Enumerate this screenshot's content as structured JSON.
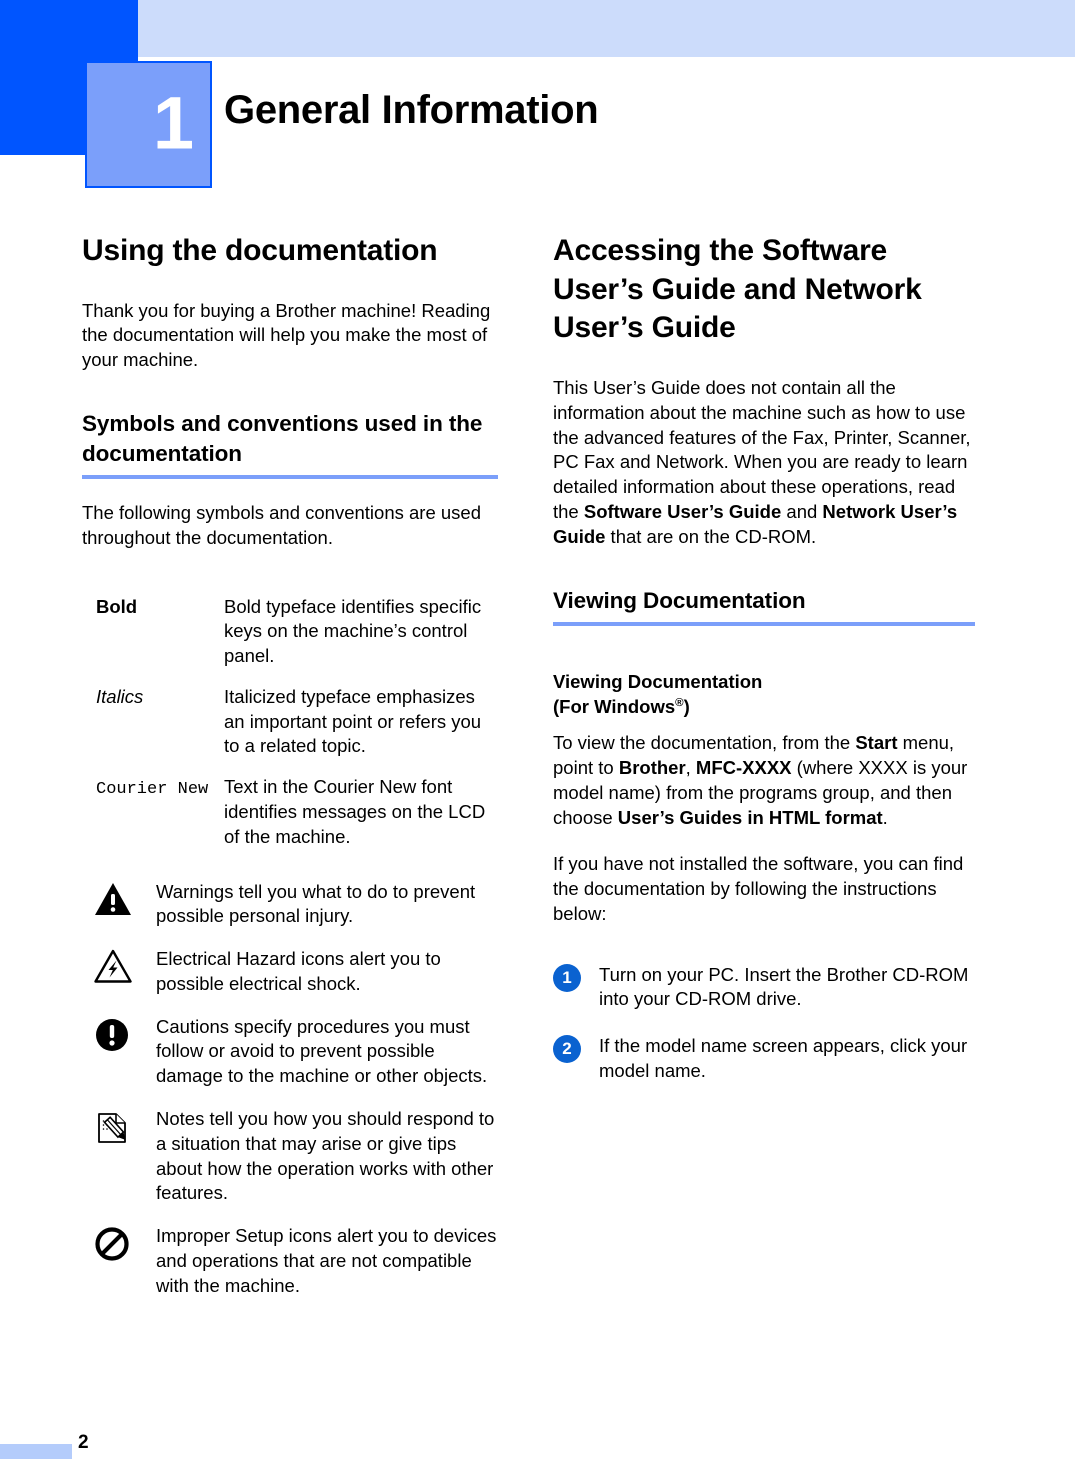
{
  "header": {
    "chapter_number": "1",
    "chapter_title": "General Information"
  },
  "left_column": {
    "section_title": "Using the documentation",
    "intro_paragraph": "Thank you for buying a Brother machine! Reading the documentation will help you make the most of your machine.",
    "symbols_heading": "Symbols and conventions used in the documentation",
    "symbols_intro": "The following symbols and conventions are used throughout the documentation.",
    "definitions": [
      {
        "term": "Bold",
        "term_style": "bold",
        "description": "Bold typeface identifies specific keys on the machine’s control panel."
      },
      {
        "term": "Italics",
        "term_style": "italic",
        "description": "Italicized typeface emphasizes an important point or refers you to a related topic."
      },
      {
        "term": "Courier New",
        "term_style": "mono",
        "description": "Text in the Courier New font identifies messages on the LCD of the machine."
      }
    ],
    "icon_notes": [
      {
        "icon": "warning-triangle-icon",
        "text": "Warnings tell you what to do to prevent possible personal injury."
      },
      {
        "icon": "electrical-hazard-icon",
        "text": "Electrical Hazard icons alert you to possible electrical shock."
      },
      {
        "icon": "caution-circle-icon",
        "text": "Cautions specify procedures you must follow or avoid to prevent possible damage to the machine or other objects."
      },
      {
        "icon": "note-pencil-icon",
        "text": "Notes tell you how you should respond to a situation that may arise or give tips about how the operation works with other features."
      },
      {
        "icon": "improper-setup-icon",
        "text": "Improper Setup icons alert you to devices and operations that are not compatible with the machine."
      }
    ]
  },
  "right_column": {
    "section_title": "Accessing the Software User’s Guide and Network User’s Guide",
    "accessing_paragraph": {
      "part1": "This User’s Guide does not contain all the information about the machine such as how to use the advanced features of the Fax, Printer, Scanner, PC Fax and Network. When you are ready to learn detailed information about these operations, read the ",
      "bold1": "Software User’s Guide",
      "part2": " and ",
      "bold2": "Network User’s Guide",
      "part3": " that are on the CD-ROM."
    },
    "viewing_heading": "Viewing Documentation",
    "viewing_sub_line1": "Viewing Documentation",
    "viewing_sub_line2_prefix": "(For Windows",
    "viewing_sub_reg": "®",
    "viewing_sub_line2_suffix": ")",
    "view_paragraph": {
      "part1": "To view the documentation, from the ",
      "bold1": "Start",
      "part2": " menu, point to ",
      "bold2": "Brother",
      "part3": ", ",
      "bold3": "MFC-XXXX",
      "part4": " (where XXXX is your model name) from the programs group, and then choose ",
      "bold4": "User’s Guides in HTML format",
      "part5": "."
    },
    "not_installed_paragraph": "If you have not installed the software, you can find the documentation by following the instructions below:",
    "steps": [
      {
        "number": "1",
        "text": "Turn on your PC. Insert the Brother CD-ROM into your CD-ROM drive."
      },
      {
        "number": "2",
        "text": "If the model name screen appears, click your model name."
      }
    ]
  },
  "footer": {
    "page_number": "2"
  },
  "colors": {
    "header_dark_blue": "#0055ff",
    "header_light_blue": "#ccdcfb",
    "chapter_box_blue": "#7b9ffa",
    "rule_blue": "#7b9ffa",
    "step_badge_blue": "#0a62d0",
    "footer_bar_blue": "#b4ccfb"
  }
}
